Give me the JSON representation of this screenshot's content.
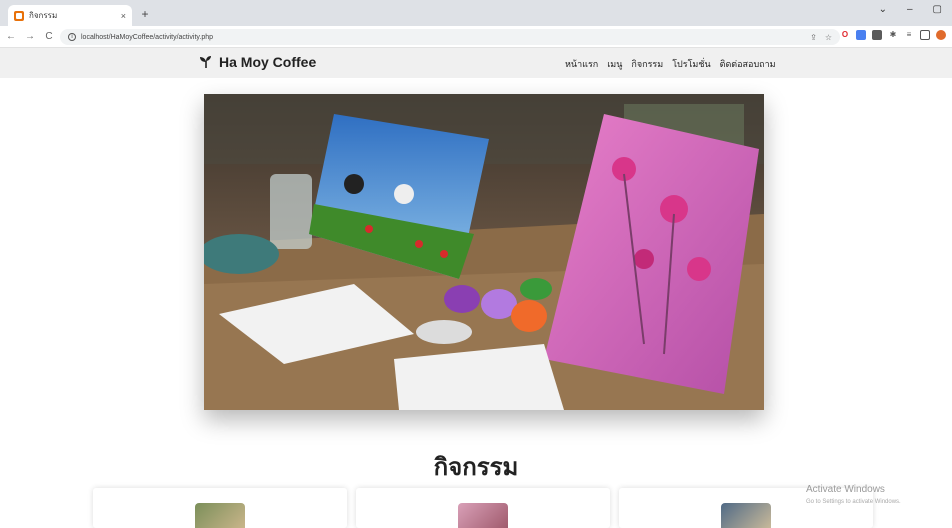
{
  "browser": {
    "tab_title": "กิจกรรม",
    "url": "localhost/HaMoyCoffee/activity/activity.php",
    "close_symbol": "×",
    "new_tab_symbol": "+",
    "window_controls": [
      "⌄",
      "–",
      "▢"
    ],
    "nav": [
      "←",
      "→",
      "C"
    ],
    "omnibox_icons": [
      "⇪",
      "☆"
    ]
  },
  "site": {
    "brand": "Ha Moy Coffee",
    "menu": [
      "หน้าแรก",
      "เมนู",
      "กิจกรรม",
      "โปรโมชั่น",
      "ติดต่อสอบถาม"
    ]
  },
  "section": {
    "title": "กิจกรรม"
  },
  "watermark": {
    "title": "Activate Windows",
    "subtitle": "Go to Settings to activate Windows."
  },
  "colors": {
    "nav_bg": "#f0f0f0",
    "accent_orange": "#e8710a"
  }
}
